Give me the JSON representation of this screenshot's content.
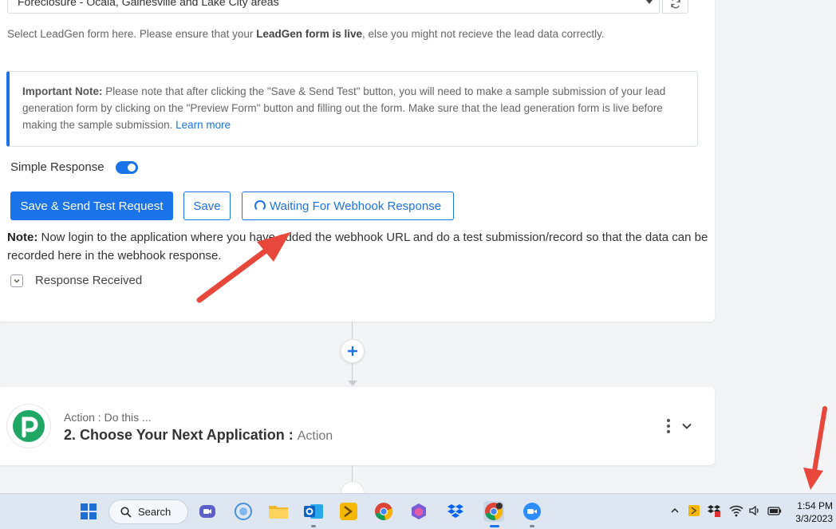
{
  "trigger": {
    "selected_form": "Foreclosure - Ocala, Gainesville and Lake City areas",
    "helper_prefix": "Select LeadGen form here. Please ensure that your ",
    "helper_bold": "LeadGen form is live",
    "helper_suffix": ", else you might not recieve the lead data correctly.",
    "important_label": "Important Note:",
    "important_text": " Please note that after clicking the \"Save & Send Test\" button, you will need to make a sample submission of your lead generation form by clicking on the \"Preview Form\" button and filling out the form. Make sure that the lead generation form is live before making the sample submission. ",
    "learn_more": "Learn more",
    "simple_response_label": "Simple Response",
    "simple_response_on": true,
    "save_send_label": "Save & Send Test Request",
    "save_label": "Save",
    "waiting_label": "Waiting For Webhook Response",
    "note_label": "Note:",
    "note_text": " Now login to the application where you have added the webhook URL and do a test submission/record so that the data can be recorded here in the webhook response.",
    "response_received_label": "Response Received"
  },
  "action": {
    "subtitle": "Action : Do this ...",
    "title": "2. Choose Your Next Application :",
    "title_suffix": "Action"
  },
  "taskbar": {
    "search_label": "Search",
    "time": "1:54 PM",
    "date": "3/3/2023"
  },
  "colors": {
    "primary": "#1a73e8",
    "annotation_arrow": "#e8473b",
    "pabbly_green": "#21a765"
  }
}
